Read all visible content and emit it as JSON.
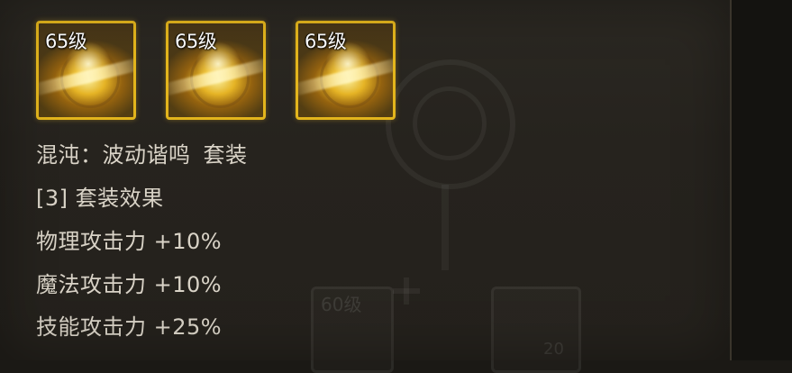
{
  "items": [
    {
      "level": "65级",
      "icon": "chaos-armor-icon"
    },
    {
      "level": "65级",
      "icon": "chaos-shoulder-icon"
    },
    {
      "level": "65级",
      "icon": "chaos-belt-icon"
    }
  ],
  "set": {
    "name": "混沌：波动谐鸣",
    "suffix": "套装"
  },
  "bonus": {
    "header": "[3] 套装效果",
    "lines": [
      "物理攻击力 +10%",
      "魔法攻击力 +10%",
      "技能攻击力 +25%"
    ]
  },
  "background": {
    "slot_level": "60级",
    "slot_count": "20"
  },
  "colors": {
    "slot_border": "#e3b51c",
    "text": "#d9d3c7",
    "panel": "#28251f"
  }
}
